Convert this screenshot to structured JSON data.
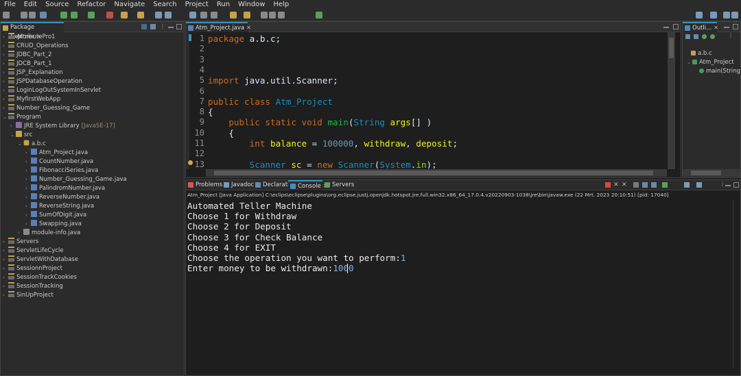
{
  "menu": [
    "File",
    "Edit",
    "Source",
    "Refactor",
    "Navigate",
    "Search",
    "Project",
    "Run",
    "Window",
    "Help"
  ],
  "package_explorer": {
    "title": "Package Explorer",
    "items": [
      {
        "label": "AttributePro1",
        "level": 0,
        "icon": "project",
        "expanded": false
      },
      {
        "label": "CRUD_Operations",
        "level": 0,
        "icon": "project",
        "expanded": false
      },
      {
        "label": "JDBC_Part_2",
        "level": 0,
        "icon": "project",
        "expanded": false
      },
      {
        "label": "JDCB_Part_1",
        "level": 0,
        "icon": "project",
        "expanded": false
      },
      {
        "label": "JSP_Explanation",
        "level": 0,
        "icon": "project",
        "expanded": false
      },
      {
        "label": "JSPDatabaseOperation",
        "level": 0,
        "icon": "project",
        "expanded": false
      },
      {
        "label": "LoginLogOutSystemInServlet",
        "level": 0,
        "icon": "project",
        "expanded": false
      },
      {
        "label": "MyfirstWebApp",
        "level": 0,
        "icon": "project",
        "expanded": false
      },
      {
        "label": "Number_Guessing_Game",
        "level": 0,
        "icon": "project",
        "expanded": false
      },
      {
        "label": "Program",
        "level": 0,
        "icon": "project",
        "expanded": true
      },
      {
        "label": "JRE System Library",
        "suffix": "[JavaSE-17]",
        "level": 1,
        "icon": "library",
        "expanded": false
      },
      {
        "label": "src",
        "level": 1,
        "icon": "source-folder",
        "expanded": true
      },
      {
        "label": "a.b.c",
        "level": 2,
        "icon": "package",
        "expanded": true
      },
      {
        "label": "Atm_Project.java",
        "level": 3,
        "icon": "java-file",
        "expanded": false
      },
      {
        "label": "CountNumber.java",
        "level": 3,
        "icon": "java-file",
        "expanded": false
      },
      {
        "label": "FibonacciSeries.java",
        "level": 3,
        "icon": "java-file",
        "expanded": false
      },
      {
        "label": "Number_Guessing_Game.java",
        "level": 3,
        "icon": "java-file",
        "expanded": false
      },
      {
        "label": "PalindromNumber.java",
        "level": 3,
        "icon": "java-file",
        "expanded": false
      },
      {
        "label": "ReverseNumber.java",
        "level": 3,
        "icon": "java-file",
        "expanded": false
      },
      {
        "label": "ReverseString.java",
        "level": 3,
        "icon": "java-file",
        "expanded": false
      },
      {
        "label": "SumOfDigit.java",
        "level": 3,
        "icon": "java-file",
        "expanded": false
      },
      {
        "label": "Swapping.java",
        "level": 3,
        "icon": "java-file",
        "expanded": false
      },
      {
        "label": "module-info.java",
        "level": 2,
        "icon": "module-file",
        "expanded": false
      },
      {
        "label": "Servers",
        "level": 0,
        "icon": "project",
        "expanded": false
      },
      {
        "label": "ServletLifeCycle",
        "level": 0,
        "icon": "project",
        "expanded": false
      },
      {
        "label": "ServletWithDatabase",
        "level": 0,
        "icon": "project",
        "expanded": false
      },
      {
        "label": "SessionnProject",
        "level": 0,
        "icon": "project",
        "expanded": false
      },
      {
        "label": "SessionTrackCookies",
        "level": 0,
        "icon": "project",
        "expanded": false
      },
      {
        "label": "SessionTracking",
        "level": 0,
        "icon": "project",
        "expanded": false
      },
      {
        "label": "SinUpProject",
        "level": 0,
        "icon": "project",
        "expanded": false
      }
    ]
  },
  "editor": {
    "tab": "Atm_Project.java",
    "lines": [
      {
        "n": "1",
        "segs": [
          {
            "t": "package",
            "c": "kw"
          },
          {
            "t": " a.b.c;",
            "c": "plain"
          }
        ]
      },
      {
        "n": "2",
        "segs": []
      },
      {
        "n": "3",
        "segs": []
      },
      {
        "n": "4",
        "segs": []
      },
      {
        "n": "5",
        "segs": [
          {
            "t": "import",
            "c": "kw"
          },
          {
            "t": " java.util.Scanner;",
            "c": "plain"
          }
        ]
      },
      {
        "n": "6",
        "segs": []
      },
      {
        "n": "7",
        "segs": [
          {
            "t": "public",
            "c": "kw"
          },
          {
            "t": " ",
            "c": "plain"
          },
          {
            "t": "class",
            "c": "kw"
          },
          {
            "t": " ",
            "c": "plain"
          },
          {
            "t": "Atm_Project",
            "c": "ty"
          }
        ]
      },
      {
        "n": "8",
        "segs": [
          {
            "t": "{",
            "c": "plain"
          }
        ]
      },
      {
        "n": "9",
        "segs": [
          {
            "t": "    ",
            "c": "plain"
          },
          {
            "t": "public",
            "c": "kw"
          },
          {
            "t": " ",
            "c": "plain"
          },
          {
            "t": "static",
            "c": "kw"
          },
          {
            "t": " ",
            "c": "plain"
          },
          {
            "t": "void",
            "c": "kw"
          },
          {
            "t": " ",
            "c": "plain"
          },
          {
            "t": "main",
            "c": "fn"
          },
          {
            "t": "(",
            "c": "plain"
          },
          {
            "t": "String",
            "c": "ty"
          },
          {
            "t": " ",
            "c": "plain"
          },
          {
            "t": "args",
            "c": "var"
          },
          {
            "t": "[] )",
            "c": "plain"
          }
        ]
      },
      {
        "n": "10",
        "segs": [
          {
            "t": "    {",
            "c": "plain"
          }
        ]
      },
      {
        "n": "11",
        "segs": [
          {
            "t": "        ",
            "c": "plain"
          },
          {
            "t": "int",
            "c": "kw"
          },
          {
            "t": " ",
            "c": "plain"
          },
          {
            "t": "balance",
            "c": "var"
          },
          {
            "t": " = ",
            "c": "plain"
          },
          {
            "t": "100000",
            "c": "num"
          },
          {
            "t": ", ",
            "c": "plain"
          },
          {
            "t": "withdraw",
            "c": "var"
          },
          {
            "t": ", ",
            "c": "plain"
          },
          {
            "t": "deposit",
            "c": "var"
          },
          {
            "t": ";",
            "c": "plain"
          }
        ]
      },
      {
        "n": "12",
        "segs": []
      },
      {
        "n": "13",
        "segs": [
          {
            "t": "        ",
            "c": "plain"
          },
          {
            "t": "Scanner",
            "c": "ty"
          },
          {
            "t": " ",
            "c": "plain"
          },
          {
            "t": "sc",
            "c": "var"
          },
          {
            "t": " = ",
            "c": "plain"
          },
          {
            "t": "new",
            "c": "kw"
          },
          {
            "t": " ",
            "c": "plain"
          },
          {
            "t": "Scanner",
            "c": "ty"
          },
          {
            "t": "(",
            "c": "plain"
          },
          {
            "t": "System",
            "c": "ty"
          },
          {
            "t": ".",
            "c": "plain"
          },
          {
            "t": "in",
            "c": "fld"
          },
          {
            "t": ");",
            "c": "plain"
          }
        ]
      }
    ]
  },
  "outline": {
    "title": "Outli...",
    "items": [
      {
        "label": "a.b.c",
        "level": 0
      },
      {
        "label": "Atm_Project",
        "level": 0
      },
      {
        "label": "main(String",
        "level": 1
      }
    ]
  },
  "console_panel": {
    "tabs": [
      "Problems",
      "Javadoc",
      "Declaration",
      "Console",
      "Servers"
    ],
    "active_tab": "Console",
    "status": "Atm_Project [Java Application] C:\\eclips\\eclipse\\plugins\\org.eclipse.justj.openjdk.hotspot.jre.full.win32.x86_64_17.0.4.v20220903-1038\\jre\\bin\\javaw.exe  (22 Mrt. 2023 20:10:51) [pid: 17040]",
    "lines": [
      {
        "text": "Automated Teller Machine"
      },
      {
        "text": "Choose 1 for Withdraw"
      },
      {
        "text": "Choose 2 for Deposit"
      },
      {
        "text": "Choose 3 for Check Balance"
      },
      {
        "text": "Choose 4 for EXIT"
      },
      {
        "text": "Choose the operation you want to perform:",
        "input": "1"
      },
      {
        "text": "Enter money to be withdrawn:",
        "input": "1000"
      }
    ]
  },
  "colors": {
    "accent": "#3592c4",
    "keyword": "#cc6c1d",
    "type": "#1290c3",
    "method": "#1eb540",
    "variable": "#f2f200",
    "stop_button": "#e0443e"
  }
}
